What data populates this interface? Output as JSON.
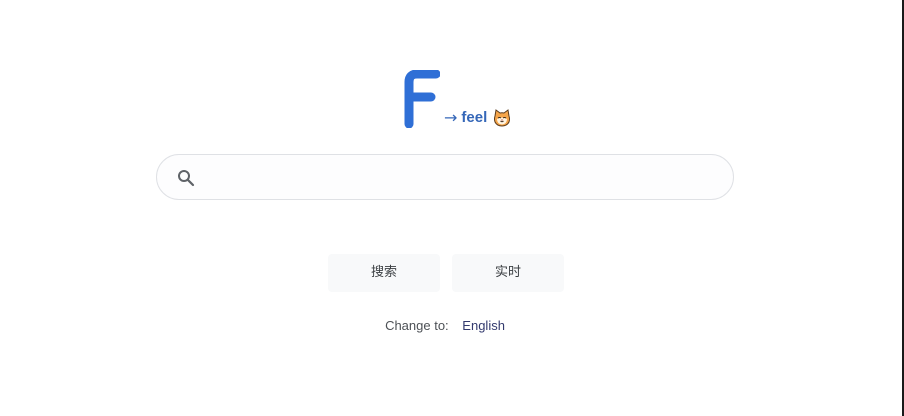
{
  "logo": {
    "letter": "F",
    "arrow": "→",
    "word": "feel",
    "mascot_icon": "cat-face-icon",
    "brand_color": "#2f6fd6",
    "text_color": "#3567b8"
  },
  "search": {
    "icon": "search-icon",
    "value": "",
    "placeholder": ""
  },
  "buttons": {
    "search_label": "搜索",
    "realtime_label": "实时"
  },
  "language": {
    "prefix": "Change to:",
    "option": "English"
  }
}
